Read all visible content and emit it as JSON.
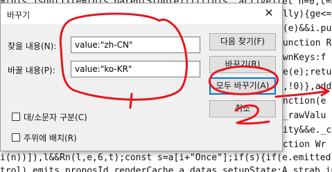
{
  "code_lines": [
    "=this.json()}(e=this.parentStop(e)|if(this._active)let n=0,t=n++",
    "ally){ge<=A",
    "o(e)&&i.pu",
    "function Re(",
    "ownKeys:f",
    "te(e);retu",
    "e,!0)},add",
    "unction(e",
    "._rawValu",
    "city&&e._c",
    "nction Wr",
    "i(n))]),l&&Rn(l,e,6,t);const s=a[i+\"Once\"];if(s){if(e.emitted){if(e.emitt",
    "trol) emits proposId renderCache a datas setupState:A strab inheri"
  ],
  "dialog": {
    "title": "바꾸기",
    "close_glyph": "✕",
    "find_label": "찾을 내용(N):",
    "find_value": "value:\"zh-CN\"",
    "replace_label": "바꿀 내용(P):",
    "replace_value": "value:\"ko-KR\"",
    "find_next_button": "다음 찾기(F)",
    "replace_button": "바꾸기(R)",
    "replace_all_button": "모두 바꾸기(A)",
    "cancel_button": "취소",
    "match_case_label": "대/소문자 구분(C)",
    "wrap_label": "주위에 배치(R)",
    "match_case_checked": false,
    "wrap_checked": false
  },
  "annotations": {
    "number_1": "1",
    "number_2": "2",
    "color": "#e8141c"
  }
}
